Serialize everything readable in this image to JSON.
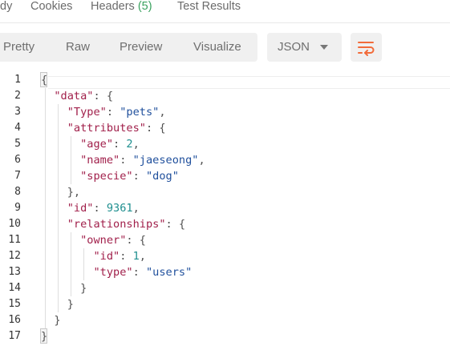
{
  "tabs": [
    {
      "label": "dy"
    },
    {
      "label": "Cookies"
    },
    {
      "label": "Headers",
      "count": "(5)"
    },
    {
      "label": "Test Results"
    }
  ],
  "view_modes": [
    "Pretty",
    "Raw",
    "Preview",
    "Visualize"
  ],
  "active_view": "Pretty",
  "format": {
    "selected": "JSON",
    "icon": "chevron-down-icon"
  },
  "wrap_icon": "wrap-lines-icon",
  "accent": "#f26b3a",
  "line_numbers": [
    "1",
    "2",
    "3",
    "4",
    "5",
    "6",
    "7",
    "8",
    "9",
    "10",
    "11",
    "12",
    "13",
    "14",
    "15",
    "16",
    "17"
  ],
  "code": {
    "l1": {
      "p": "{"
    },
    "l2": {
      "k": "\"data\"",
      "p": ": {"
    },
    "l3": {
      "k": "\"Type\"",
      "p1": ": ",
      "s": "\"pets\"",
      "p2": ","
    },
    "l4": {
      "k": "\"attributes\"",
      "p": ": {"
    },
    "l5": {
      "k": "\"age\"",
      "p1": ": ",
      "n": "2",
      "p2": ","
    },
    "l6": {
      "k": "\"name\"",
      "p1": ": ",
      "s": "\"jaeseong\"",
      "p2": ","
    },
    "l7": {
      "k": "\"specie\"",
      "p1": ": ",
      "s": "\"dog\""
    },
    "l8": {
      "p": "},"
    },
    "l9": {
      "k": "\"id\"",
      "p1": ": ",
      "n": "9361",
      "p2": ","
    },
    "l10": {
      "k": "\"relationships\"",
      "p": ": {"
    },
    "l11": {
      "k": "\"owner\"",
      "p": ": {"
    },
    "l12": {
      "k": "\"id\"",
      "p1": ": ",
      "n": "1",
      "p2": ","
    },
    "l13": {
      "k": "\"type\"",
      "p1": ": ",
      "s": "\"users\""
    },
    "l14": {
      "p": "}"
    },
    "l15": {
      "p": "}"
    },
    "l16": {
      "p": "}"
    },
    "l17": {
      "p": "}"
    }
  }
}
